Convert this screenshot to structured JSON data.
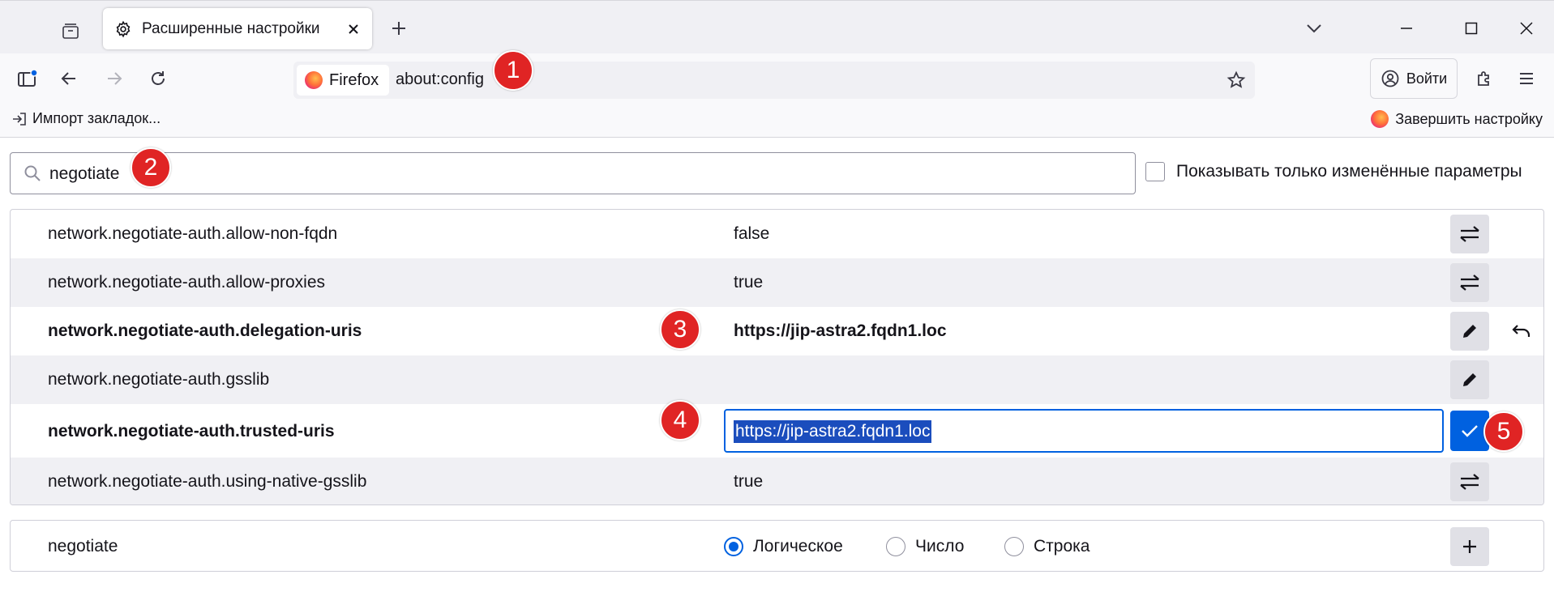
{
  "tab": {
    "title": "Расширенные настройки"
  },
  "urlbar": {
    "identity_label": "Firefox",
    "url": "about:config"
  },
  "account": {
    "signin_label": "Войти"
  },
  "bookmarks": {
    "import_label": "Импорт закладок...",
    "finish_label": "Завершить настройку"
  },
  "search": {
    "value": "negotiate",
    "only_modified_label": "Показывать только изменённые параметры"
  },
  "prefs": [
    {
      "name": "network.negotiate-auth.allow-non-fqdn",
      "value": "false"
    },
    {
      "name": "network.negotiate-auth.allow-proxies",
      "value": "true"
    },
    {
      "name": "network.negotiate-auth.delegation-uris",
      "value": "https://jip-astra2.fqdn1.loc"
    },
    {
      "name": "network.negotiate-auth.gsslib",
      "value": ""
    },
    {
      "name": "network.negotiate-auth.trusted-uris",
      "value": "https://jip-astra2.fqdn1.loc"
    },
    {
      "name": "network.negotiate-auth.using-native-gsslib",
      "value": "true"
    }
  ],
  "add_row": {
    "name": "negotiate",
    "types": [
      "Логическое",
      "Число",
      "Строка"
    ],
    "selected_type": "Логическое"
  },
  "annotations": [
    "1",
    "2",
    "3",
    "4",
    "5"
  ],
  "colors": {
    "accent": "#0061e0",
    "badge": "#e02424"
  }
}
